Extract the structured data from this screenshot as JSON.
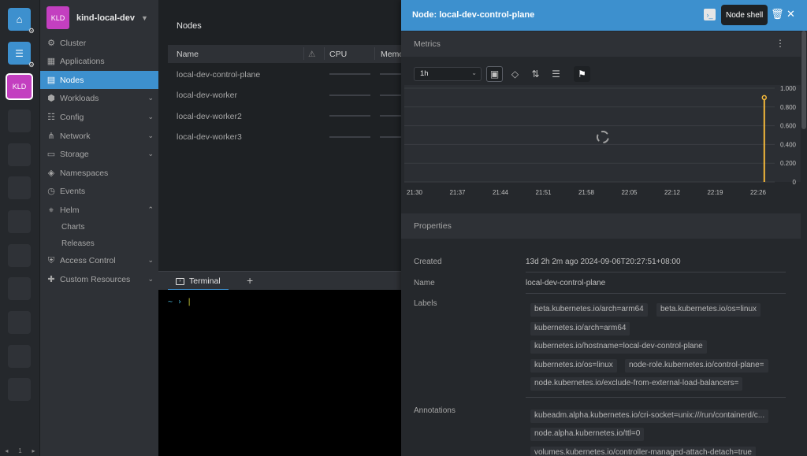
{
  "hotbar": {
    "cluster_short": "KLD",
    "pager": {
      "prev": "◂",
      "page": "1",
      "next": "▸"
    }
  },
  "sidebar": {
    "cluster_avatar": "KLD",
    "cluster_name": "kind-local-dev",
    "items": [
      {
        "label": "Cluster",
        "icon": "cluster-icon"
      },
      {
        "label": "Applications",
        "icon": "applications-icon"
      },
      {
        "label": "Nodes",
        "icon": "nodes-icon",
        "active": true
      },
      {
        "label": "Workloads",
        "icon": "workloads-icon"
      },
      {
        "label": "Config",
        "icon": "config-icon"
      },
      {
        "label": "Network",
        "icon": "network-icon"
      },
      {
        "label": "Storage",
        "icon": "storage-icon"
      },
      {
        "label": "Namespaces",
        "icon": "namespaces-icon"
      },
      {
        "label": "Events",
        "icon": "events-icon"
      },
      {
        "label": "Helm",
        "icon": "helm-icon",
        "expanded": true
      },
      {
        "label": "Access Control",
        "icon": "access-control-icon"
      },
      {
        "label": "Custom Resources",
        "icon": "custom-resources-icon"
      }
    ],
    "helm_sub": [
      "Charts",
      "Releases"
    ]
  },
  "main": {
    "title": "Nodes",
    "columns": [
      "Name",
      "CPU",
      "Memo"
    ],
    "warning_glyph": "⚠",
    "rows": [
      "local-dev-control-plane",
      "local-dev-worker",
      "local-dev-worker2",
      "local-dev-worker3"
    ]
  },
  "terminal": {
    "tab_label": "Terminal",
    "plus": "+",
    "prompt": "~ ›",
    "cursor": "|"
  },
  "drawer": {
    "title": "Node: local-dev-control-plane",
    "tooltip": "Node shell",
    "metrics": {
      "section_title": "Metrics",
      "range": "1h",
      "menu": "⋮"
    },
    "properties": {
      "section_title": "Properties",
      "created_label": "Created",
      "created_value": "13d 2h 2m ago 2024-09-06T20:27:51+08:00",
      "name_label": "Name",
      "name_value": "local-dev-control-plane",
      "labels_label": "Labels",
      "labels": [
        "beta.kubernetes.io/arch=arm64",
        "beta.kubernetes.io/os=linux",
        "kubernetes.io/arch=arm64",
        "kubernetes.io/hostname=local-dev-control-plane",
        "kubernetes.io/os=linux",
        "node-role.kubernetes.io/control-plane=",
        "node.kubernetes.io/exclude-from-external-load-balancers="
      ],
      "annotations_label": "Annotations",
      "annotations": [
        "kubeadm.alpha.kubernetes.io/cri-socket=unix:///run/containerd/c...",
        "node.alpha.kubernetes.io/ttl=0",
        "volumes.kubernetes.io/controller-managed-attach-detach=true"
      ]
    }
  },
  "chart_data": {
    "type": "line",
    "x": [
      "21:30",
      "21:37",
      "21:44",
      "21:51",
      "21:58",
      "22:05",
      "22:12",
      "22:19",
      "22:26"
    ],
    "ytick_labels": [
      "0",
      "0.200",
      "0.400",
      "0.600",
      "0.800",
      "1.000"
    ],
    "ylim": [
      0,
      1.0
    ],
    "series": [
      {
        "values": [
          {
            "x": "22:27",
            "y": 0.9
          }
        ],
        "color": "#f5b93a"
      }
    ],
    "loading": true
  },
  "colors": {
    "accent": "#3d90ce",
    "cluster": "#c33fc0",
    "series": "#f5b93a"
  }
}
